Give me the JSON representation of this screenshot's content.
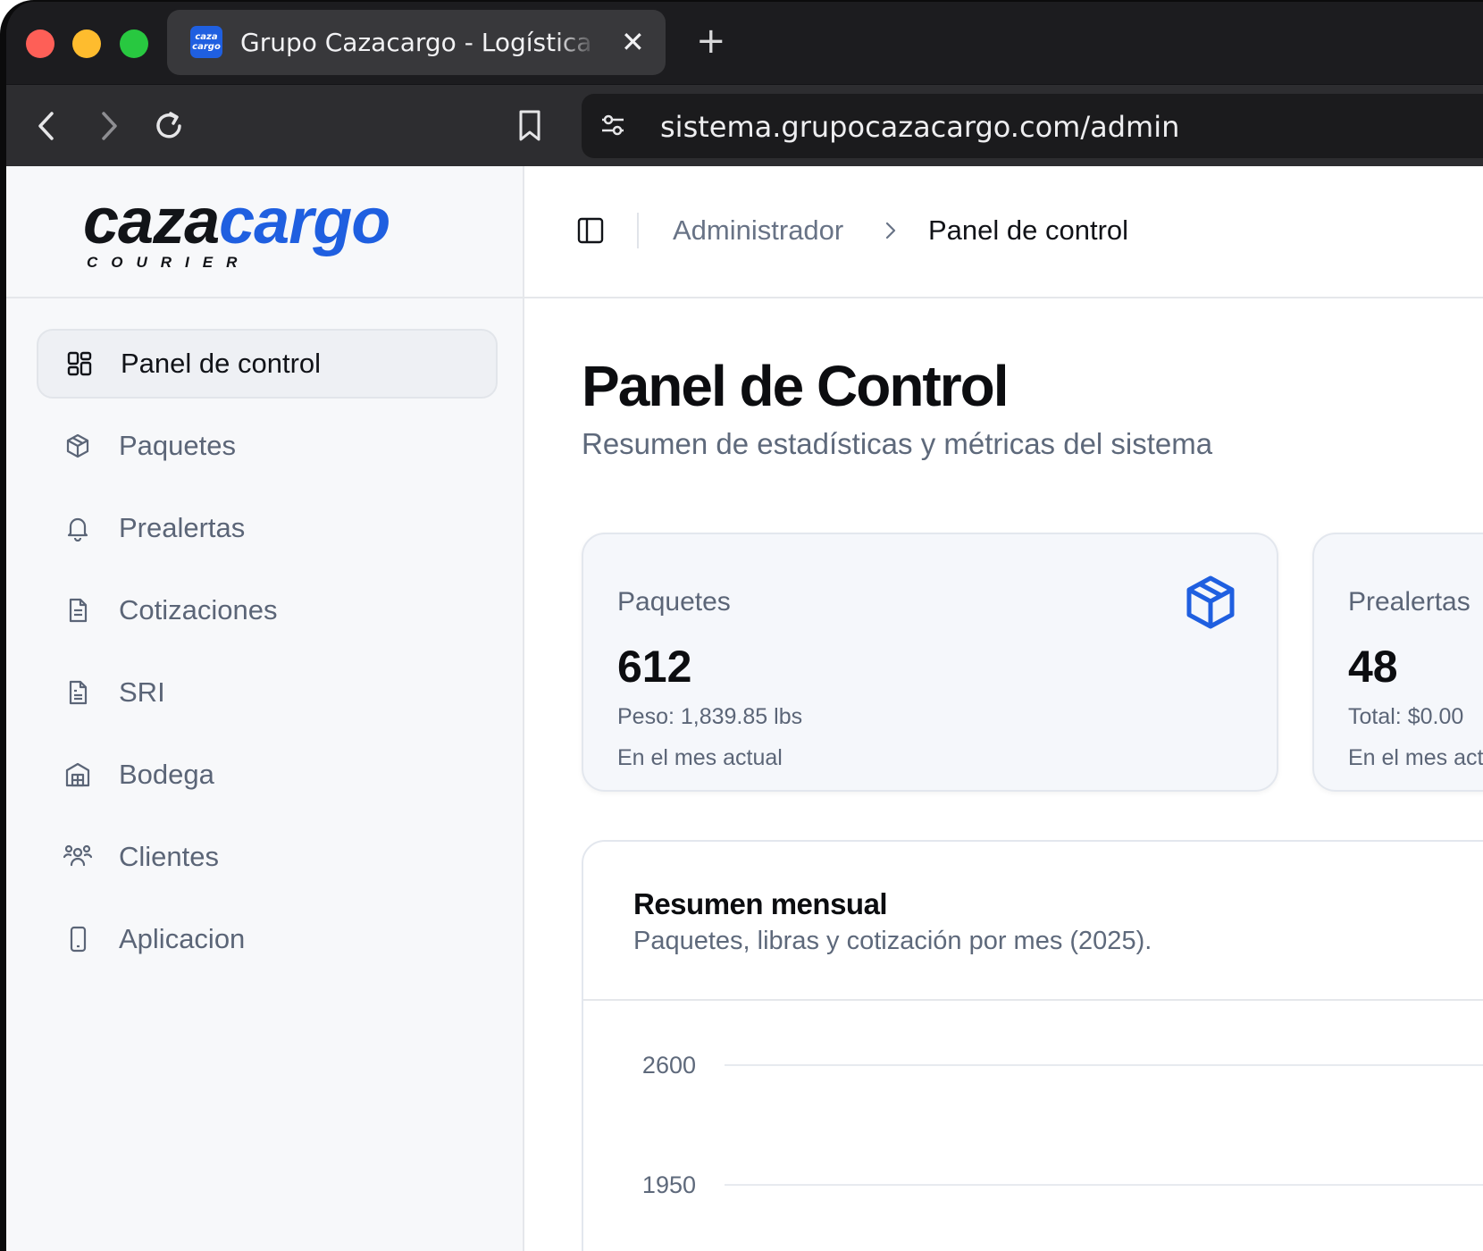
{
  "browser": {
    "tab_title": "Grupo Cazacargo - Logística Global",
    "favicon_text": "caza cargo",
    "close_glyph": "✕",
    "new_tab_glyph": "+",
    "url": "sistema.grupocazacargo.com/admin"
  },
  "brand": {
    "logo_part1": "caza",
    "logo_part2": "cargo",
    "logo_sub": "COURIER",
    "accent_color": "#1f5fe0"
  },
  "sidebar": {
    "items": [
      {
        "label": "Panel de control",
        "icon": "dashboard-icon",
        "active": true
      },
      {
        "label": "Paquetes",
        "icon": "package-icon"
      },
      {
        "label": "Prealertas",
        "icon": "bell-icon"
      },
      {
        "label": "Cotizaciones",
        "icon": "document-icon"
      },
      {
        "label": "SRI",
        "icon": "receipt-icon"
      },
      {
        "label": "Bodega",
        "icon": "warehouse-icon"
      },
      {
        "label": "Clientes",
        "icon": "users-icon"
      },
      {
        "label": "Aplicacion",
        "icon": "smartphone-icon"
      }
    ]
  },
  "header": {
    "breadcrumb": [
      "Administrador",
      "Panel de control"
    ]
  },
  "main": {
    "title": "Panel de Control",
    "subtitle": "Resumen de estadísticas y métricas del sistema",
    "stats": [
      {
        "label": "Paquetes",
        "value": "612",
        "line1": "Peso: 1,839.85 lbs",
        "line2": "En el mes actual",
        "icon": "box-icon"
      },
      {
        "label": "Prealertas",
        "value": "48",
        "line1": "Total: $0.00",
        "line2": "En el mes actual"
      }
    ]
  },
  "chart_data": {
    "type": "bar",
    "title": "Resumen mensual",
    "subtitle": "Paquetes, libras y cotización por mes (2025).",
    "y_ticks": [
      "2600",
      "1950"
    ],
    "grid": true
  }
}
